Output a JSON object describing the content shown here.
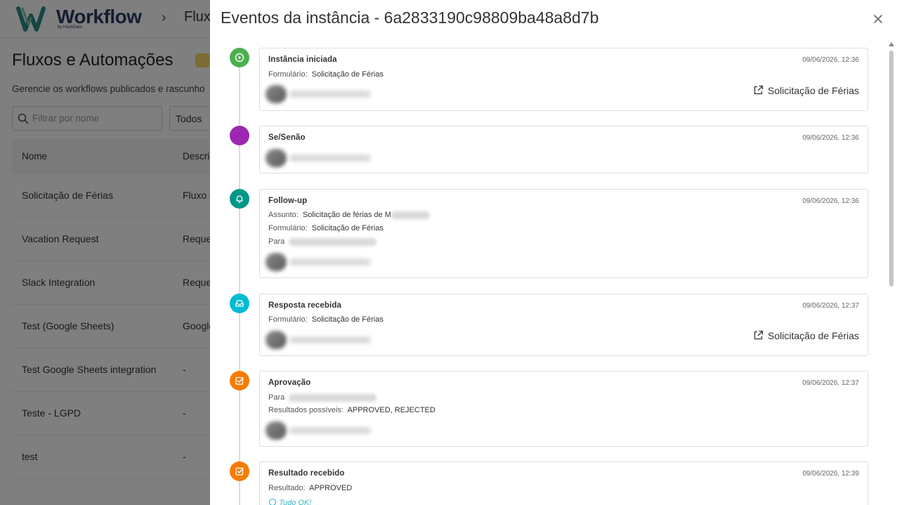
{
  "app": {
    "logo_text": "Workflow",
    "logo_sub": "by HashData",
    "breadcrumb": "Flux"
  },
  "page": {
    "title": "Fluxos e Automações",
    "subtitle": "Gerencie os workflows publicados e rascunho",
    "search_placeholder": "Filtrar por nome",
    "filter_value": "Todos",
    "columns": {
      "name": "Nome",
      "desc": "Descri"
    },
    "rows": [
      {
        "name": "Solicitação de Férias",
        "desc": "Fluxo d"
      },
      {
        "name": "Vacation Request",
        "desc": "Reque"
      },
      {
        "name": "Slack Integration",
        "desc": "Reque"
      },
      {
        "name": "Test (Google Sheets)",
        "desc": "Google"
      },
      {
        "name": "Test Google Sheets integration",
        "desc": "-"
      },
      {
        "name": "Teste - LGPD",
        "desc": "-"
      },
      {
        "name": "test",
        "desc": "-"
      }
    ]
  },
  "drawer": {
    "title": "Eventos da instância - 6a2833190c98809ba48a8d7b",
    "events": [
      {
        "title": "Instância iniciada",
        "time": "09/06/2026, 12:36",
        "color": "#4caf50",
        "icon": "play-circle-icon",
        "form_key": "Formulário:",
        "form_value": "Solicitação de Férias",
        "link_label": "Solicitação de Férias"
      },
      {
        "title": "Se/Senão",
        "time": "09/06/2026, 12:36",
        "color": "#9c27b0",
        "icon": "none"
      },
      {
        "title": "Follow-up",
        "time": "09/06/2026, 12:36",
        "color": "#009688",
        "icon": "bell-icon",
        "subject_key": "Assunto:",
        "subject_value": "Solicitação de férias de M",
        "form_key": "Formulário:",
        "form_value": "Solicitação de Férias",
        "to_key": "Para"
      },
      {
        "title": "Resposta recebida",
        "time": "09/06/2026, 12:37",
        "color": "#00bcd4",
        "icon": "inbox-icon",
        "form_key": "Formulário:",
        "form_value": "Solicitação de Férias",
        "link_label": "Solicitação de Férias"
      },
      {
        "title": "Aprovação",
        "time": "09/06/2026, 12:37",
        "color": "#f57c00",
        "icon": "checkbox-icon",
        "to_key": "Para",
        "results_key": "Resultados possíveis:",
        "results_value": "APPROVED, REJECTED"
      },
      {
        "title": "Resultado recebido",
        "time": "09/06/2026, 12:39",
        "color": "#f57c00",
        "icon": "checkbox-icon",
        "result_key": "Resultado:",
        "result_value": "APPROVED",
        "comment": "Tudo OK!"
      }
    ]
  }
}
